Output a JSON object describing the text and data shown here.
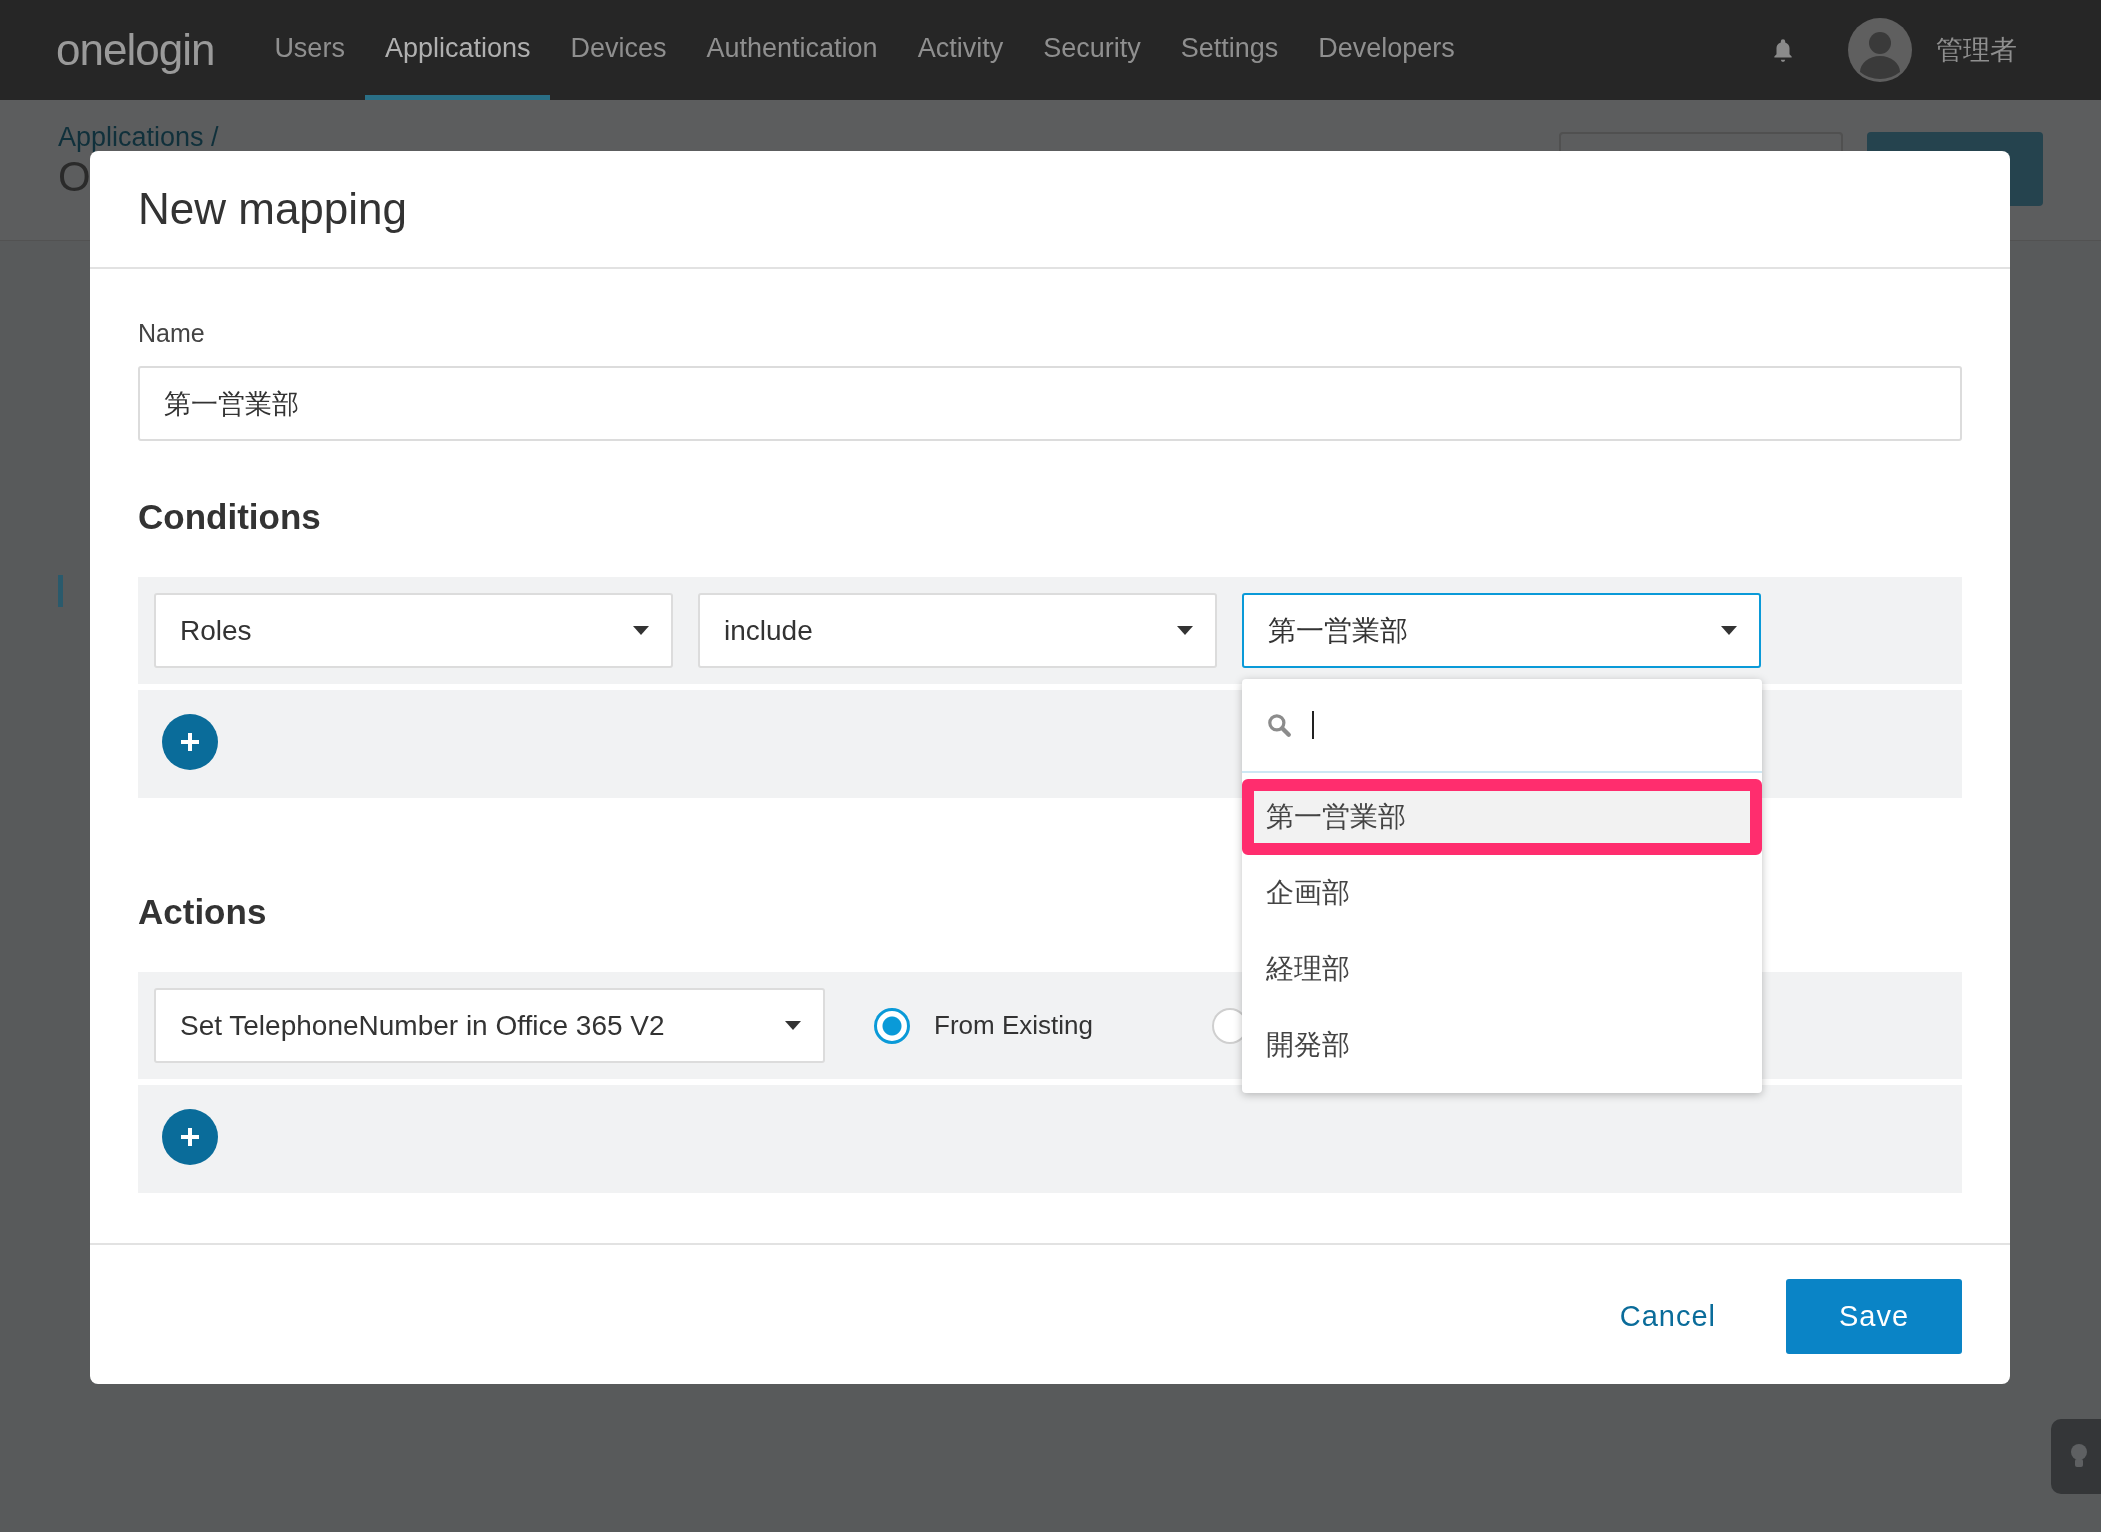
{
  "nav": {
    "logo": "onelogin",
    "tabs": [
      {
        "label": "Users",
        "selected": false
      },
      {
        "label": "Applications",
        "selected": true
      },
      {
        "label": "Devices",
        "selected": false
      },
      {
        "label": "Authentication",
        "selected": false
      },
      {
        "label": "Activity",
        "selected": false
      },
      {
        "label": "Security",
        "selected": false
      },
      {
        "label": "Settings",
        "selected": false
      },
      {
        "label": "Developers",
        "selected": false
      }
    ],
    "user": "管理者"
  },
  "page": {
    "breadcrumb": "Applications /",
    "title": "O"
  },
  "modal": {
    "title": "New mapping",
    "name_label": "Name",
    "name_value": "第一営業部",
    "conditions": {
      "heading": "Conditions",
      "selects": [
        {
          "value": "Roles",
          "focused": false
        },
        {
          "value": "include",
          "focused": false
        },
        {
          "value": "第一営業部",
          "focused": true
        }
      ]
    },
    "dropdown": {
      "options": [
        {
          "label": "第一営業部",
          "selected": true
        },
        {
          "label": "企画部",
          "selected": false
        },
        {
          "label": "経理部",
          "selected": false
        },
        {
          "label": "開発部",
          "selected": false
        }
      ]
    },
    "actions": {
      "heading": "Actions",
      "select": "Set TelephoneNumber in Office 365 V2",
      "radios": [
        {
          "label": "From Existing",
          "selected": true
        },
        {
          "selected": false
        }
      ]
    },
    "cancel": "Cancel",
    "save": "Save"
  }
}
